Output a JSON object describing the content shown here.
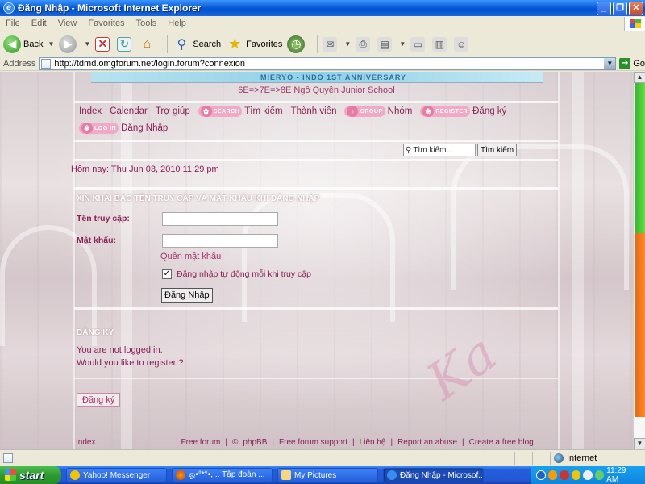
{
  "window": {
    "title": "Đăng Nhập - Microsoft Internet Explorer",
    "minimize_glyph": "_",
    "maximize_glyph": "❐",
    "close_glyph": "✕"
  },
  "menubar": {
    "items": [
      "File",
      "Edit",
      "View",
      "Favorites",
      "Tools",
      "Help"
    ]
  },
  "toolbar": {
    "back_label": "Back",
    "search_label": "Search",
    "favorites_label": "Favorites"
  },
  "addressbar": {
    "label": "Address",
    "url": "http://tdmd.omgforum.net/login.forum?connexion",
    "go_label": "Go"
  },
  "page": {
    "banner_text": "MIERYO - INDO   1ST ANNIVERSARY",
    "site_name": "6E=>7E=>8E Ngô Quyền Junior School",
    "nav": {
      "index": "Index",
      "calendar": "Calendar",
      "help": "Trợ giúp",
      "search_img": "SEARCH",
      "search": "Tìm kiếm",
      "members": "Thành viên",
      "group_img": "GROUP",
      "groups": "Nhóm",
      "register_img": "REGISTER",
      "register": "Đăng ký",
      "login_img": "LOG IN",
      "login": "Đăng Nhập"
    },
    "search_box": {
      "placeholder": "Tìm kiếm...",
      "button": "Tìm kiếm"
    },
    "date_text": "Hôm nay: Thu Jun 03, 2010 11:29 pm",
    "login_form": {
      "title": "XIN KHAI BÁO TÊN TRUY CẬP VÀ MẬT KHẨU KHI ĐĂNG NHẬP",
      "username_label": "Tên truy cập:",
      "username_value": "",
      "password_label": "Mật khẩu:",
      "password_value": "",
      "forgot_link": "Quên mật khẩu",
      "autologin_label": "Đăng nhập tự động mỗi khi truy cập",
      "autologin_checked": true,
      "submit": "Đăng Nhập"
    },
    "register_section": {
      "title": "ĐĂNG KÝ",
      "line1": "You are not logged in.",
      "line2": "Would you like to register ?",
      "button": "Đăng ký"
    },
    "footer": {
      "index": "Index",
      "free_forum": "Free forum",
      "copyright": "©",
      "phpbb": "phpBB",
      "support": "Free forum support",
      "contact": "Liên hệ",
      "abuse": "Report an abuse",
      "create": "Create a free blog"
    },
    "watermark": "Ka"
  },
  "statusbar": {
    "zone": "Internet"
  },
  "taskbar": {
    "start": "start",
    "tasks": [
      {
        "label": "Yahoo! Messenger",
        "active": false
      },
      {
        "label": "ஓ•°*°•, .. Tập đoàn ...",
        "active": false
      },
      {
        "label": "My Pictures",
        "active": false
      },
      {
        "label": "Đăng Nhập - Microsof...",
        "active": true
      }
    ],
    "clock": "11:29 AM"
  },
  "colors": {
    "link": "#8a1f55",
    "accent_pink": "#f2a9c6",
    "scroll_green": "#2fb52f",
    "scroll_orange": "#e8660e",
    "xp_blue": "#245edb"
  }
}
